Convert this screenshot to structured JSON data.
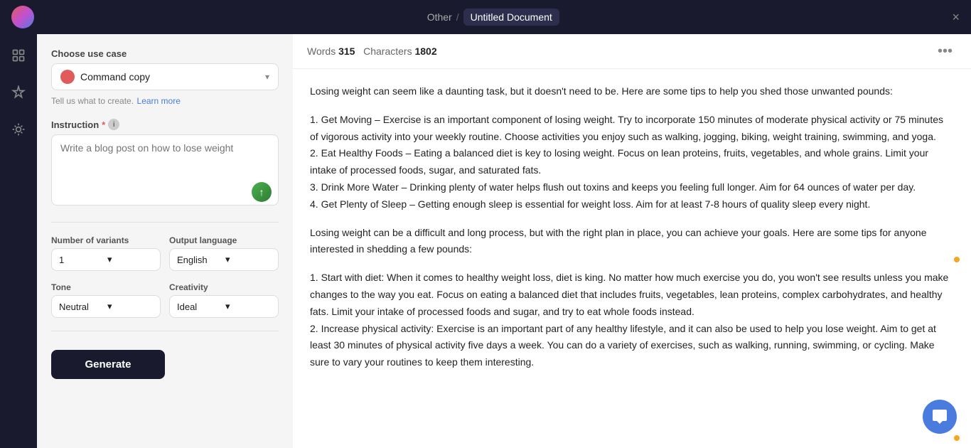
{
  "topbar": {
    "other_label": "Other",
    "slash": "/",
    "document_title": "Untitled Document",
    "close_label": "×"
  },
  "left_panel": {
    "choose_use_case_label": "Choose use case",
    "use_case_value": "Command copy",
    "hint_text": "Tell us what to create.",
    "learn_more_label": "Learn more",
    "instruction_label": "Instruction",
    "instruction_required": "*",
    "instruction_placeholder": "Write a blog post on how to lose weight",
    "number_variants_label": "Number of variants",
    "number_variants_value": "1",
    "output_language_label": "Output language",
    "output_language_value": "English",
    "tone_label": "Tone",
    "tone_value": "Neutral",
    "creativity_label": "Creativity",
    "creativity_value": "Ideal",
    "generate_btn": "Generate"
  },
  "content_header": {
    "words_label": "Words",
    "words_value": "315",
    "characters_label": "Characters",
    "characters_value": "1802"
  },
  "content_body": {
    "paragraph1": "Losing weight can seem like a daunting task, but it doesn't need to be. Here are some tips to help you shed those unwanted pounds:",
    "list1": "1. Get Moving – Exercise is an important component of losing weight. Try to incorporate 150 minutes of moderate physical activity or 75 minutes of vigorous activity into your weekly routine. Choose activities you enjoy such as walking, jogging, biking, weight training, swimming, and yoga.\n2. Eat Healthy Foods – Eating a balanced diet is key to losing weight. Focus on lean proteins, fruits, vegetables, and whole grains. Limit your intake of processed foods, sugar, and saturated fats.\n3. Drink More Water – Drinking plenty of water helps flush out toxins and keeps you feeling full longer. Aim for 64 ounces of water per day.\n4. Get Plenty of Sleep – Getting enough sleep is essential for weight loss. Aim for at least 7-8 hours of quality sleep every night.",
    "paragraph2": "Losing weight can be a difficult and long process, but with the right plan in place, you can achieve your goals. Here are some tips for anyone interested in shedding a few pounds:",
    "list2": "1. Start with diet: When it comes to healthy weight loss, diet is king. No matter how much exercise you do, you won't see results unless you make changes to the way you eat. Focus on eating a balanced diet that includes fruits, vegetables, lean proteins, complex carbohydrates, and healthy fats. Limit your intake of processed foods and sugar, and try to eat whole foods instead.\n2. Increase physical activity: Exercise is an important part of any healthy lifestyle, and it can also be used to help you lose weight. Aim to get at least 30 minutes of physical activity five days a week. You can do a variety of exercises, such as walking, running, swimming, or cycling. Make sure to vary your routines to keep them interesting."
  },
  "icons": {
    "logo": "◉",
    "menu_icon": "⊞",
    "sparkle_icon": "✦",
    "magic_icon": "◈",
    "chevron_down": "▾",
    "send_icon": "↑",
    "more_icon": "•••",
    "chat_icon": "💬"
  }
}
